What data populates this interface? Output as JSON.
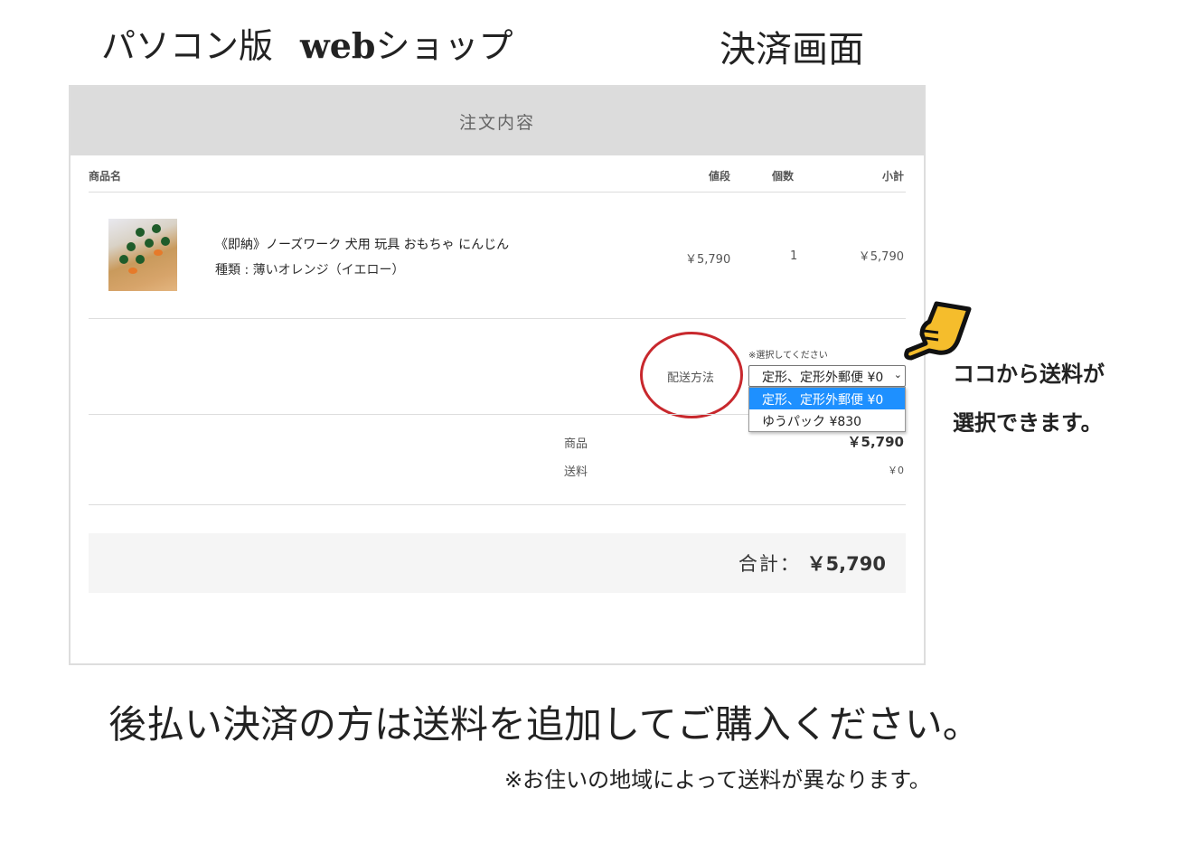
{
  "header": {
    "left_title": "パソコン版",
    "left_bold": "web",
    "left_suffix": "ショップ",
    "right_title": "決済画面"
  },
  "panel": {
    "title": "注文内容",
    "columns": {
      "name": "商品名",
      "price": "値段",
      "qty": "個数",
      "subtotal": "小計"
    },
    "item": {
      "name": "《即納》ノーズワーク 犬用 玩具 おもちゃ にんじん",
      "variant": "種類 : 薄いオレンジ（イエロー）",
      "price": "￥5,790",
      "qty": "1",
      "subtotal": "￥5,790"
    },
    "shipping": {
      "label": "配送方法",
      "hint": "※選択してください",
      "selected": "定形、定形外郵便 ¥0",
      "options": [
        "定形、定形外郵便 ¥0",
        "ゆうパック ¥830"
      ]
    },
    "summary": {
      "goods_label": "商品",
      "goods_value": "￥5,790",
      "shipping_label": "送料",
      "shipping_value": "￥0"
    },
    "total": {
      "label": "合計：",
      "value": "￥5,790"
    }
  },
  "callout": {
    "line1": "ココから送料が",
    "line2": "選択できます。"
  },
  "notes": {
    "main": "後払い決済の方は送料を追加してご購入ください。",
    "sub": "※お住いの地域によって送料が異なります。"
  }
}
